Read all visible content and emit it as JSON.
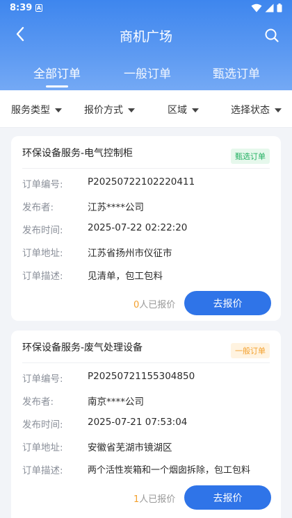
{
  "status_bar": {
    "time": "8:39",
    "notification_glyph": "A"
  },
  "nav": {
    "title": "商机广场"
  },
  "tabs": [
    {
      "label": "全部订单",
      "active": true
    },
    {
      "label": "一般订单",
      "active": false
    },
    {
      "label": "甄选订单",
      "active": false
    }
  ],
  "filters": [
    {
      "label": "服务类型"
    },
    {
      "label": "报价方式"
    },
    {
      "label": "区域"
    },
    {
      "label": "选择状态"
    }
  ],
  "labels": {
    "order_no": "订单编号:",
    "publisher": "发布者:",
    "publish_time": "发布时间:",
    "address": "订单地址:",
    "description": "订单描述:"
  },
  "orders": [
    {
      "title": "环保设备服务-电气控制柜",
      "badge": "甄选订单",
      "order_no": "P20250722102220411",
      "publisher": "江苏****公司",
      "publish_time": "2025-07-22 02:22:20",
      "address": "江苏省扬州市仪征市",
      "description": "见清单，包工包料",
      "quote_count": "0",
      "quote_suffix": "人已报价",
      "button": "去报价"
    },
    {
      "title": "环保设备服务-废气处理设备",
      "badge": "一般订单",
      "order_no": "P20250721155304850",
      "publisher": "南京****公司",
      "publish_time": "2025-07-21 07:53:04",
      "address": "安徽省芜湖市镜湖区",
      "description": "两个活性炭箱和一个烟囱拆除，包工包料",
      "quote_count": "1",
      "quote_suffix": "人已报价",
      "button": "去报价"
    }
  ],
  "colors": {
    "header_gradient_top": "#3e86ee",
    "accent": "#2f74e8",
    "badge_select": "#23b062",
    "badge_normal": "#f3a02d"
  }
}
